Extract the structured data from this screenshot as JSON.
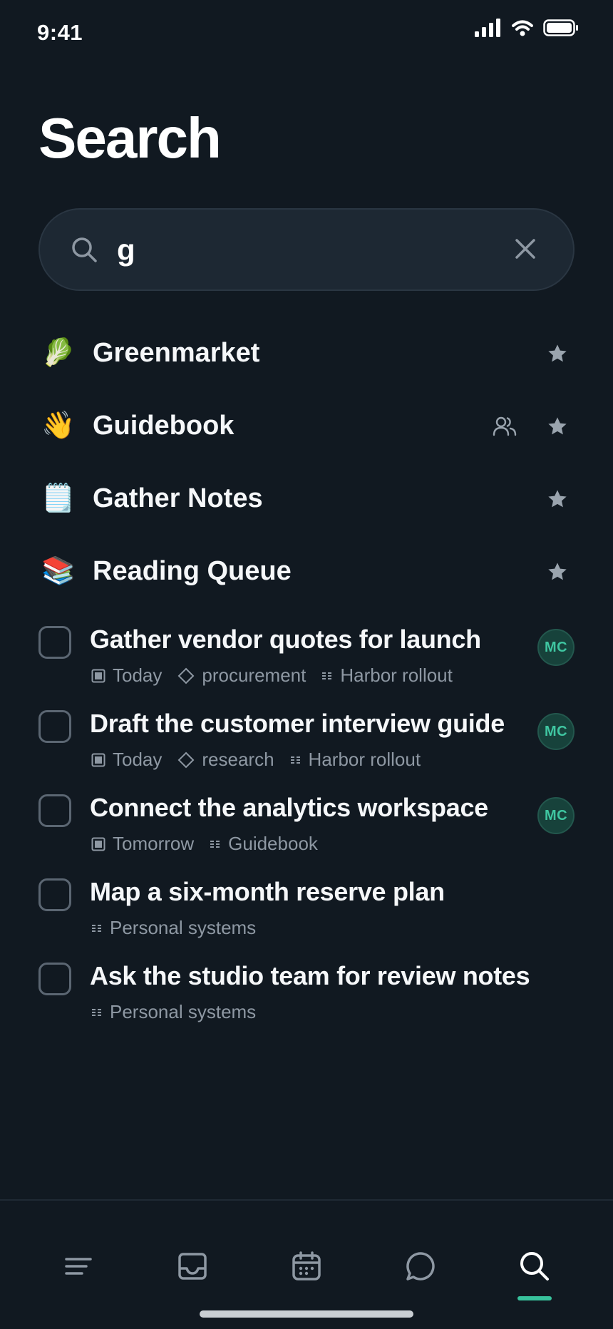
{
  "status_bar": {
    "time": "9:41"
  },
  "page": {
    "title": "Search"
  },
  "search": {
    "value": "g",
    "placeholder": ""
  },
  "projects": [
    {
      "emoji": "🥬",
      "name": "Greenmarket",
      "shared": false,
      "favorite": true
    },
    {
      "emoji": "👋",
      "name": "Guidebook",
      "shared": true,
      "favorite": true
    },
    {
      "emoji": "🗒️",
      "name": "Gather Notes",
      "shared": false,
      "favorite": true
    },
    {
      "emoji": "📚",
      "name": "Reading Queue",
      "shared": false,
      "favorite": true
    }
  ],
  "tasks": [
    {
      "title": "Gather vendor quotes for launch",
      "date": "Today",
      "tag": "procurement",
      "project": "Harbor rollout",
      "assignee": "MC"
    },
    {
      "title": "Draft the customer interview guide",
      "date": "Today",
      "tag": "research",
      "project": "Harbor rollout",
      "assignee": "MC"
    },
    {
      "title": "Connect the analytics workspace",
      "date": "Tomorrow",
      "tag": "",
      "project": "Guidebook",
      "assignee": "MC"
    },
    {
      "title": "Map a six-month reserve plan",
      "date": "",
      "tag": "",
      "project": "Personal systems",
      "assignee": ""
    },
    {
      "title": "Ask the studio team for review notes",
      "date": "",
      "tag": "",
      "project": "Personal systems",
      "assignee": ""
    }
  ],
  "tab_bar": {
    "tabs": [
      {
        "icon": "list-icon",
        "active": false
      },
      {
        "icon": "inbox-icon",
        "active": false
      },
      {
        "icon": "calendar-icon",
        "active": false
      },
      {
        "icon": "chat-icon",
        "active": false
      },
      {
        "icon": "search-icon",
        "active": true
      }
    ]
  },
  "colors": {
    "background": "#111921",
    "accent": "#38c29c",
    "muted": "#8e98a3"
  }
}
